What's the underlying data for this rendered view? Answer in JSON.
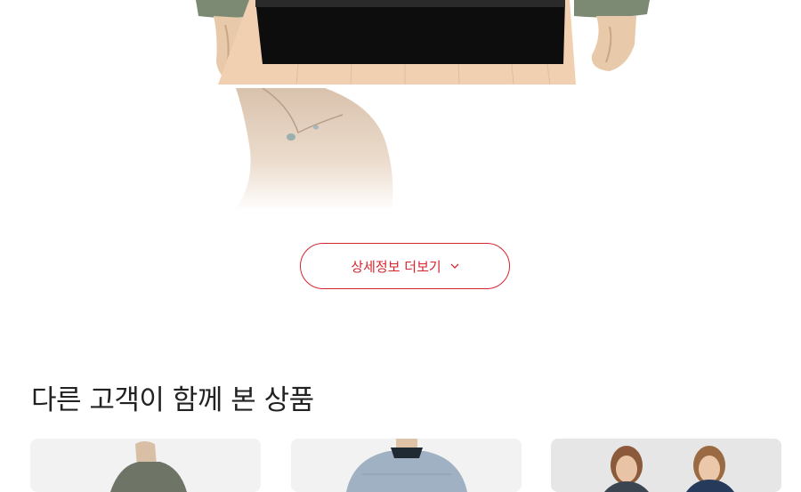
{
  "detail": {
    "more_button_label": "상세정보 더보기",
    "more_button_icon": "chevron-down-icon",
    "accent_color": "#d5262e"
  },
  "related": {
    "title": "다른 고객이 함께 본 상품",
    "products": [
      {
        "image": "mannequin-gray-jacket"
      },
      {
        "image": "mannequin-light-blue-padded-jacket"
      },
      {
        "image": "two-models-photo"
      }
    ]
  }
}
